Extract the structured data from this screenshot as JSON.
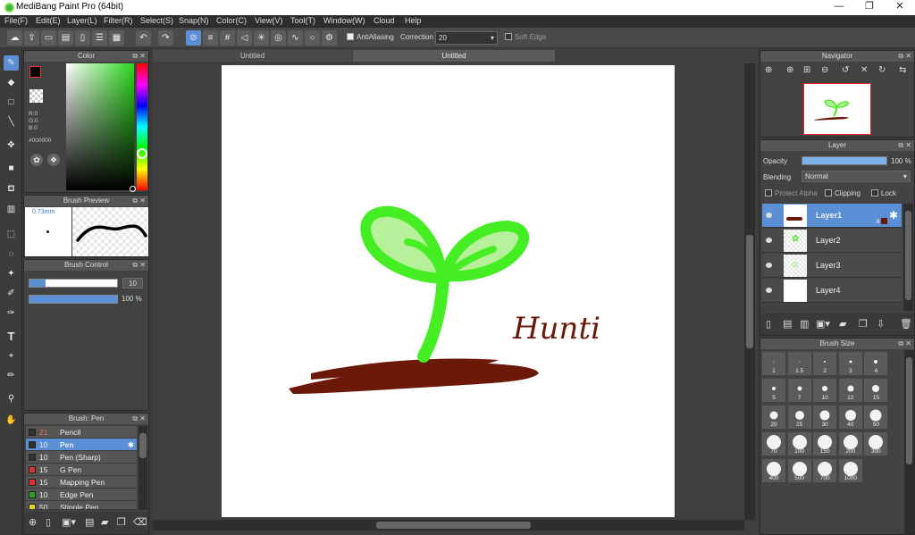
{
  "window": {
    "title": "MediBang Paint Pro (64bit)",
    "minimize": "—",
    "maximize": "❐",
    "close": "✕"
  },
  "menu": [
    "File(F)",
    "Edit(E)",
    "Layer(L)",
    "Filter(R)",
    "Select(S)",
    "Snap(N)",
    "Color(C)",
    "View(V)",
    "Tool(T)",
    "Window(W)",
    "Cloud",
    "Help"
  ],
  "toolbar": {
    "antialiasing_label": "AntiAliasing",
    "correction_label": "Correction",
    "correction_value": "20",
    "soft_edge_label": "Soft Edge"
  },
  "color_panel": {
    "title": "Color",
    "fg_color": "#000000",
    "bg_color": "#ffffff",
    "r": "R:0",
    "g": "G:0",
    "b": "B:0",
    "hex": "#000000"
  },
  "brush_preview": {
    "title": "Brush Preview",
    "size": "0.73mm"
  },
  "brush_control": {
    "title": "Brush Control",
    "size_value": "10",
    "opacity_value": "100 %"
  },
  "brush_list": {
    "title": "Brush: Pen",
    "items": [
      {
        "size": "21",
        "name": "Pencil",
        "color": "#333333",
        "size_color": "#ff6a6a"
      },
      {
        "size": "10",
        "name": "Pen",
        "color": "#333333",
        "size_color": "#ffffff"
      },
      {
        "size": "10",
        "name": "Pen (Sharp)",
        "color": "#333333",
        "size_color": "#ffffff"
      },
      {
        "size": "15",
        "name": "G Pen",
        "color": "#e03030",
        "size_color": "#ffffff"
      },
      {
        "size": "15",
        "name": "Mapping Pen",
        "color": "#e03030",
        "size_color": "#ffffff"
      },
      {
        "size": "10",
        "name": "Edge Pen",
        "color": "#2aa02a",
        "size_color": "#ffffff"
      },
      {
        "size": "50",
        "name": "Stipple Pen",
        "color": "#e8d020",
        "size_color": "#ffffff"
      }
    ]
  },
  "documents": {
    "tab1": "Untitled",
    "tab2": "Untitled"
  },
  "canvas": {
    "handwriting": "Hunti",
    "sprout_color": "#44ee22",
    "leaf_fill": "#b7f09a",
    "soil_color": "#6b1a0a"
  },
  "navigator": {
    "title": "Navigator"
  },
  "layer_panel": {
    "title": "Layer",
    "opacity_label": "Opacity",
    "opacity_value": "100 %",
    "opacity_fraction": 1.0,
    "blending_label": "Blending",
    "blending_value": "Normal",
    "protect_alpha": "Protect Alpha",
    "clipping": "Clipping",
    "lock": "Lock",
    "layers": [
      {
        "name": "Layer1",
        "selected": true,
        "badge": "8"
      },
      {
        "name": "Layer2",
        "selected": false
      },
      {
        "name": "Layer3",
        "selected": false
      },
      {
        "name": "Layer4",
        "selected": false
      }
    ]
  },
  "brush_size": {
    "title": "Brush Size",
    "sizes": [
      "1",
      "1.5",
      "2",
      "3",
      "4",
      "5",
      "7",
      "10",
      "12",
      "15",
      "20",
      "25",
      "30",
      "40",
      "50",
      "70",
      "100",
      "150",
      "200",
      "300",
      "400",
      "500",
      "700",
      "1000"
    ]
  }
}
